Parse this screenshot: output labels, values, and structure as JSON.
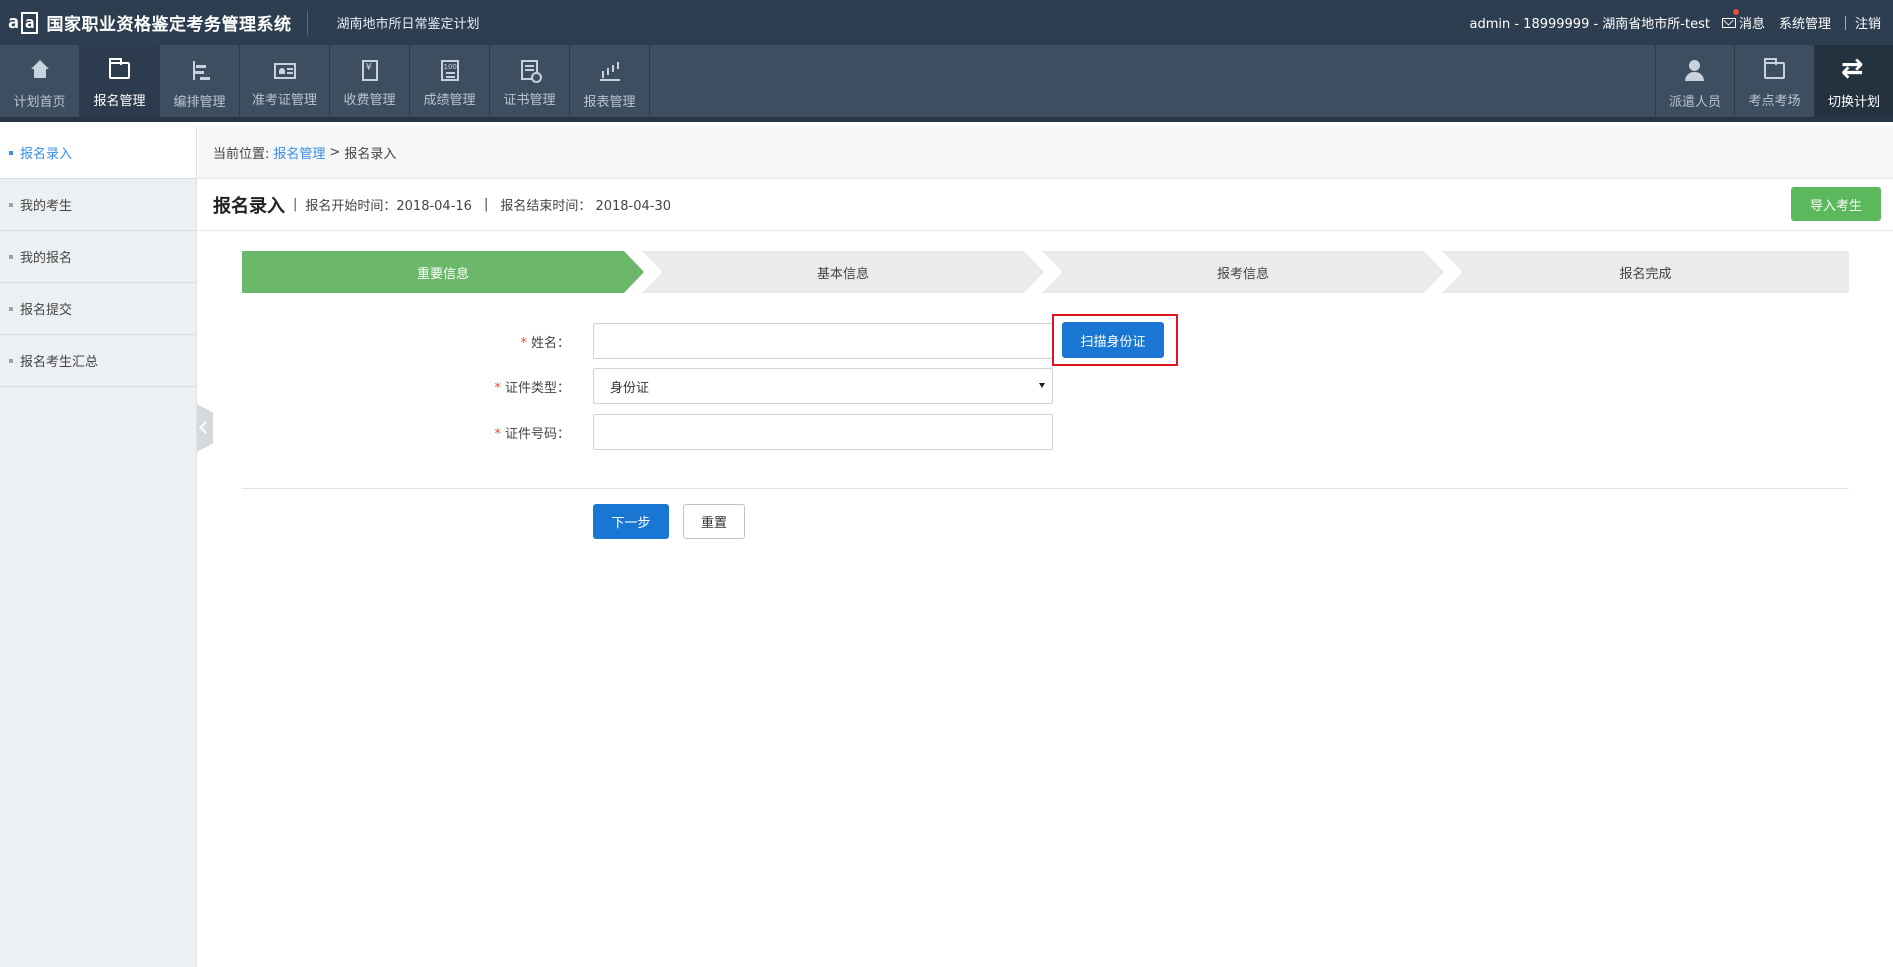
{
  "topbar": {
    "logo_text": "a",
    "logo_box": "a",
    "system_title": "国家职业资格鉴定考务管理系统",
    "plan_name": "湖南地市所日常鉴定计划",
    "user_info": "admin - 18999999 - 湖南省地市所-test",
    "messages": "消息",
    "system_admin": "系统管理",
    "logout": "注销"
  },
  "nav": {
    "items": [
      {
        "label": "计划首页",
        "icon": "home-icon"
      },
      {
        "label": "报名管理",
        "icon": "folder-icon",
        "active": true
      },
      {
        "label": "编排管理",
        "icon": "align-bars-icon"
      },
      {
        "label": "准考证管理",
        "icon": "id-card-icon"
      },
      {
        "label": "收费管理",
        "icon": "receipt-icon"
      },
      {
        "label": "成绩管理",
        "icon": "score-sheet-icon"
      },
      {
        "label": "证书管理",
        "icon": "certificate-icon"
      },
      {
        "label": "报表管理",
        "icon": "bar-chart-icon"
      }
    ],
    "right_items": [
      {
        "label": "派遣人员",
        "icon": "user-icon"
      },
      {
        "label": "考点考场",
        "icon": "folder-icon"
      },
      {
        "label": "切换计划",
        "icon": "swap-icon"
      }
    ]
  },
  "sidebar": {
    "items": [
      {
        "label": "报名录入",
        "active": true
      },
      {
        "label": "我的考生"
      },
      {
        "label": "我的报名"
      },
      {
        "label": "报名提交"
      },
      {
        "label": "报名考生汇总"
      }
    ]
  },
  "breadcrumb": {
    "prefix": "当前位置:",
    "link": "报名管理",
    "separator": ">",
    "current": "报名录入"
  },
  "header": {
    "title": "报名录入",
    "divider": "|",
    "start_time": "报名开始时间：2018-04-16",
    "meta_sep": "|",
    "end_time": "报名结束时间： 2018-04-30",
    "import_button": "导入考生"
  },
  "steps": [
    "重要信息",
    "基本信息",
    "报考信息",
    "报名完成"
  ],
  "form": {
    "required_mark": "*",
    "name_label": "姓名：",
    "name_value": "",
    "scan_button": "扫描身份证",
    "id_type_label": "证件类型：",
    "id_type_value": "身份证",
    "id_number_label": "证件号码：",
    "id_number_value": "",
    "next_button": "下一步",
    "reset_button": "重置"
  },
  "colors": {
    "topbar_bg": "#2d3e50",
    "navbar_bg": "#3d4e61",
    "step_active": "#6bb86a",
    "primary_button": "#1976d2",
    "import_button": "#5cb85c",
    "highlight_border": "#e0161d"
  }
}
